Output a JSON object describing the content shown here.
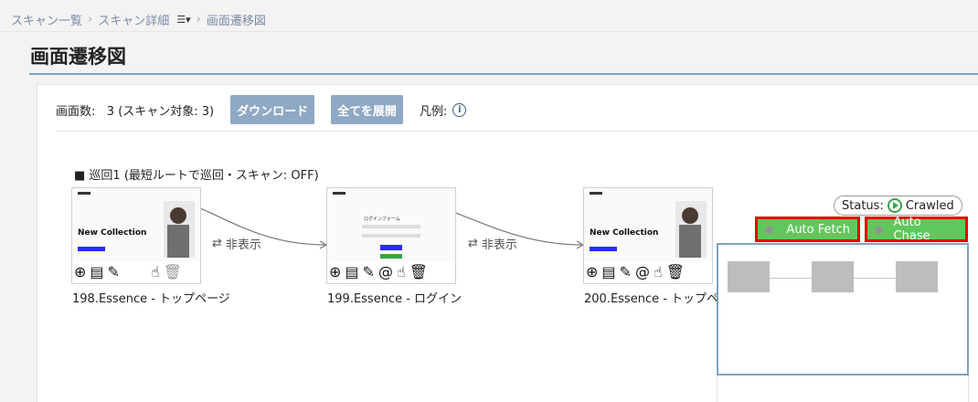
{
  "breadcrumb": {
    "items": [
      "スキャン一覧",
      "スキャン詳細",
      "画面遷移図"
    ],
    "menu_icon": "list-icon"
  },
  "page": {
    "title": "画面遷移図"
  },
  "toolbar": {
    "screen_count_label": "画面数:",
    "screen_count_value": "3 (スキャン対象: 3)",
    "download_label": "ダウンロード",
    "expand_all_label": "全てを展開",
    "legend_label": "凡例:"
  },
  "route": {
    "label": "■ 巡回1 (最短ルートで巡回・スキャン: OFF)"
  },
  "nodes": [
    {
      "caption": "198.Essence - トップページ",
      "thumb_title": "New Collection"
    },
    {
      "caption": "199.Essence - ログイン",
      "thumb_title": "ログインフォーム"
    },
    {
      "caption": "200.Essence - トップペ",
      "thumb_title": "New Collection"
    }
  ],
  "edges": [
    {
      "label": "非表示"
    },
    {
      "label": "非表示"
    }
  ],
  "status": {
    "label": "Status:",
    "value": "Crawled"
  },
  "actions": {
    "auto_fetch": "Auto Fetch",
    "auto_chase": "Auto Chase"
  },
  "colors": {
    "accent": "#8fa8c4",
    "green": "#5fc85c",
    "highlight_border": "#e30000"
  }
}
